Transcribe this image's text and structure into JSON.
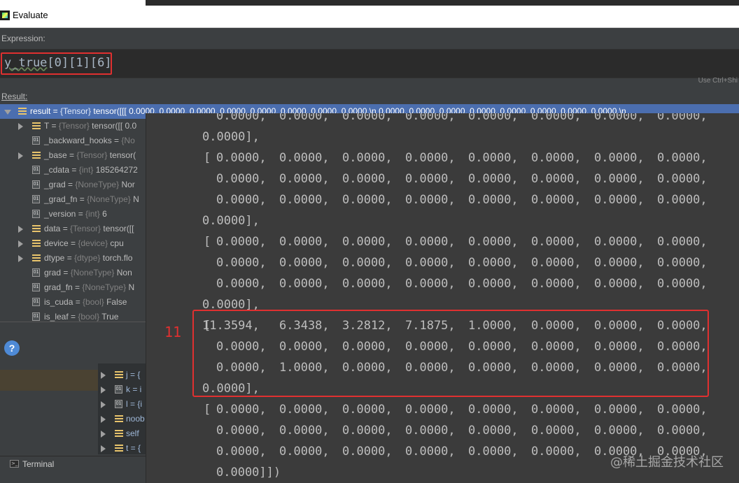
{
  "window": {
    "title": "Evaluate"
  },
  "expression": {
    "label": "Expression:",
    "ident": "y_true",
    "suffix": "[0][1][6]",
    "hint": "Use Ctrl+Shi"
  },
  "result": {
    "label": "Result:"
  },
  "tree": [
    {
      "name": "result",
      "type": "{Tensor}",
      "value": "tensor([[[ 0.0000,  0.0000,  0.0000,  0.0000,  0.0000,  0.0000,  0.0000,  0.0000,\\n          0.0000,  0.0000,  0.0000,  0.0000,  0.0000,  0.0000,  0.0000,  0.0000,\\n",
      "icon": "list-icon",
      "expand": "down",
      "indent": 0
    },
    {
      "name": "T",
      "type": "{Tensor}",
      "value": "tensor([[ 0.0",
      "icon": "list-icon",
      "expand": "right",
      "indent": 1
    },
    {
      "name": "_backward_hooks",
      "type": "{No",
      "value": "",
      "icon": "field-icon",
      "expand": "",
      "indent": 1
    },
    {
      "name": "_base",
      "type": "{Tensor}",
      "value": "tensor(",
      "icon": "list-icon",
      "expand": "right",
      "indent": 1
    },
    {
      "name": "_cdata",
      "type": "{int}",
      "value": "185264272",
      "icon": "field-icon",
      "expand": "",
      "indent": 1
    },
    {
      "name": "_grad",
      "type": "{NoneType}",
      "value": "Nor",
      "icon": "field-icon",
      "expand": "",
      "indent": 1
    },
    {
      "name": "_grad_fn",
      "type": "{NoneType}",
      "value": "N",
      "icon": "field-icon",
      "expand": "",
      "indent": 1
    },
    {
      "name": "_version",
      "type": "{int}",
      "value": "6",
      "icon": "field-icon",
      "expand": "",
      "indent": 1
    },
    {
      "name": "data",
      "type": "{Tensor}",
      "value": "tensor([[",
      "icon": "list-icon",
      "expand": "right",
      "indent": 1
    },
    {
      "name": "device",
      "type": "{device}",
      "value": "cpu",
      "icon": "list-icon",
      "expand": "right",
      "indent": 1
    },
    {
      "name": "dtype",
      "type": "{dtype}",
      "value": "torch.flo",
      "icon": "list-icon",
      "expand": "right",
      "indent": 1
    },
    {
      "name": "grad",
      "type": "{NoneType}",
      "value": "Non",
      "icon": "field-icon",
      "expand": "",
      "indent": 1
    },
    {
      "name": "grad_fn",
      "type": "{NoneType}",
      "value": "N",
      "icon": "field-icon",
      "expand": "",
      "indent": 1
    },
    {
      "name": "is_cuda",
      "type": "{bool}",
      "value": "False",
      "icon": "field-icon",
      "expand": "",
      "indent": 1
    },
    {
      "name": "is_leaf",
      "type": "{bool}",
      "value": "True",
      "icon": "field-icon",
      "expand": "",
      "indent": 1
    }
  ],
  "background_vars": [
    {
      "name": "j",
      "rest": "= {",
      "icon": "list-icon"
    },
    {
      "name": "k",
      "rest": "= i",
      "icon": "field-icon"
    },
    {
      "name": "l",
      "rest": "= {i",
      "icon": "field-icon"
    },
    {
      "name": "noob",
      "rest": "",
      "icon": "list-icon"
    },
    {
      "name": "self",
      "rest": "",
      "icon": "list-icon"
    },
    {
      "name": "t",
      "rest": "= {",
      "icon": "list-icon"
    }
  ],
  "terminal": {
    "label": "Terminal"
  },
  "tensor_popup": {
    "lines": [
      {
        "prefix": "",
        "values": [
          "0.0000,",
          "0.0000,",
          "0.0000,",
          "0.0000,",
          "0.0000,",
          "0.0000,",
          "0.0000,",
          "0.0000,"
        ]
      },
      {
        "prefix": "",
        "values": [
          "0.0000],"
        ]
      },
      {
        "prefix": "[",
        "values": [
          "0.0000,",
          "0.0000,",
          "0.0000,",
          "0.0000,",
          "0.0000,",
          "0.0000,",
          "0.0000,",
          "0.0000,"
        ]
      },
      {
        "prefix": "",
        "values": [
          "0.0000,",
          "0.0000,",
          "0.0000,",
          "0.0000,",
          "0.0000,",
          "0.0000,",
          "0.0000,",
          "0.0000,"
        ]
      },
      {
        "prefix": "",
        "values": [
          "0.0000,",
          "0.0000,",
          "0.0000,",
          "0.0000,",
          "0.0000,",
          "0.0000,",
          "0.0000,",
          "0.0000,"
        ]
      },
      {
        "prefix": "",
        "values": [
          "0.0000],"
        ]
      },
      {
        "prefix": "[",
        "values": [
          "0.0000,",
          "0.0000,",
          "0.0000,",
          "0.0000,",
          "0.0000,",
          "0.0000,",
          "0.0000,",
          "0.0000,"
        ]
      },
      {
        "prefix": "",
        "values": [
          "0.0000,",
          "0.0000,",
          "0.0000,",
          "0.0000,",
          "0.0000,",
          "0.0000,",
          "0.0000,",
          "0.0000,"
        ]
      },
      {
        "prefix": "",
        "values": [
          "0.0000,",
          "0.0000,",
          "0.0000,",
          "0.0000,",
          "0.0000,",
          "0.0000,",
          "0.0000,",
          "0.0000,"
        ]
      },
      {
        "prefix": "",
        "values": [
          "0.0000],"
        ]
      },
      {
        "prefix": "[",
        "values": [
          "11.3594,",
          "6.3438,",
          "3.2812,",
          "7.1875,",
          "1.0000,",
          "0.0000,",
          "0.0000,",
          "0.0000,"
        ]
      },
      {
        "prefix": "",
        "values": [
          "0.0000,",
          "0.0000,",
          "0.0000,",
          "0.0000,",
          "0.0000,",
          "0.0000,",
          "0.0000,",
          "0.0000,"
        ]
      },
      {
        "prefix": "",
        "values": [
          "0.0000,",
          "1.0000,",
          "0.0000,",
          "0.0000,",
          "0.0000,",
          "0.0000,",
          "0.0000,",
          "0.0000,"
        ]
      },
      {
        "prefix": "",
        "values": [
          "0.0000],"
        ]
      },
      {
        "prefix": "[",
        "values": [
          "0.0000,",
          "0.0000,",
          "0.0000,",
          "0.0000,",
          "0.0000,",
          "0.0000,",
          "0.0000,",
          "0.0000,"
        ]
      },
      {
        "prefix": "",
        "values": [
          "0.0000,",
          "0.0000,",
          "0.0000,",
          "0.0000,",
          "0.0000,",
          "0.0000,",
          "0.0000,",
          "0.0000,"
        ]
      },
      {
        "prefix": "",
        "values": [
          "0.0000,",
          "0.0000,",
          "0.0000,",
          "0.0000,",
          "0.0000,",
          "0.0000,",
          "0.0000,",
          "0.0000,"
        ]
      },
      {
        "prefix": "",
        "values": [
          "0.0000]])"
        ]
      }
    ]
  },
  "annotation": {
    "text": "11"
  },
  "watermark": {
    "text": "@稀土掘金技术社区"
  },
  "colors": {
    "selection": "#4b6eaf",
    "highlight": "#e03030",
    "background": "#3c3f41"
  }
}
